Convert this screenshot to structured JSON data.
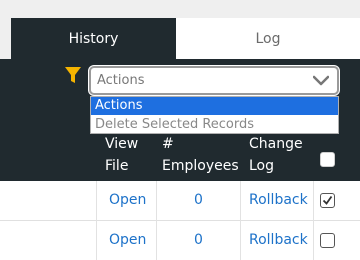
{
  "tabs": [
    {
      "label": "History",
      "active": true
    },
    {
      "label": "Log",
      "active": false
    }
  ],
  "toolbar": {
    "filter_icon": "filter-icon",
    "filter_color": "#f5b400",
    "actions_select": {
      "value": "Actions",
      "options": [
        "Actions",
        "Delete Selected Records"
      ],
      "highlighted_index": 0
    }
  },
  "table": {
    "headers": {
      "view_file": [
        "View",
        "File"
      ],
      "employees": [
        "#",
        "Employees"
      ],
      "change_log": [
        "Change",
        "Log"
      ]
    },
    "rows": [
      {
        "view": "Open",
        "employees": "0",
        "change_log": "Rollback",
        "checked": true
      },
      {
        "view": "Open",
        "employees": "0",
        "change_log": "Rollback",
        "checked": false
      }
    ]
  },
  "colors": {
    "header_bg": "#202a2f",
    "link": "#1d72c9",
    "highlight": "#1e6fe0"
  }
}
